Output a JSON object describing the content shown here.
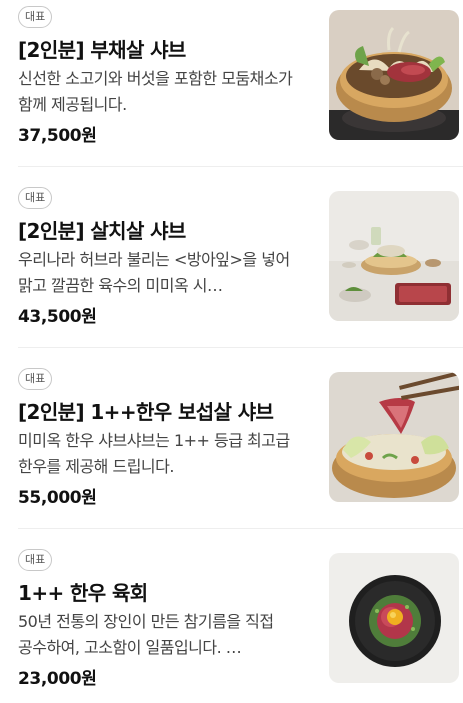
{
  "menu": {
    "items": [
      {
        "badge": "대표",
        "name": "[2인분] 부채살 샤브",
        "description": "신선한 소고기와 버섯을 포함한 모둠채소가 함께 제공됩니다.",
        "price": "37,500원"
      },
      {
        "badge": "대표",
        "name": "[2인분] 살치살 샤브",
        "description": "우리나라 허브라 불리는 <방아잎>을 넣어 맑고 깔끔한 육수의 미미옥 시…",
        "price": "43,500원"
      },
      {
        "badge": "대표",
        "name": "[2인분] 1++한우 보섭살 샤브",
        "description": "미미옥 한우 샤브샤브는 1++ 등급 최고급 한우를 제공해 드립니다.",
        "price": "55,000원"
      },
      {
        "badge": "대표",
        "name": "1++ 한우 육회",
        "description": "50년 전통의 장인이 만든 참기름을 직접 공수하여, 고소함이 일품입니다. …",
        "price": "23,000원"
      }
    ]
  }
}
